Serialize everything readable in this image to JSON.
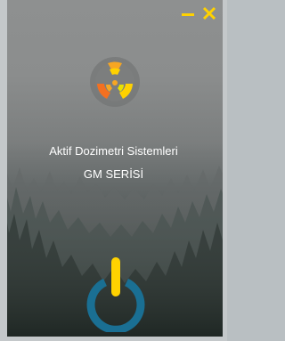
{
  "window": {
    "accent_color": "#ffd200",
    "minimize_icon": "minimize-icon",
    "close_icon": "close-icon"
  },
  "app": {
    "title": "Aktif Dozimetri Sistemleri",
    "subtitle": "GM SERİSİ",
    "logo_icon": "radiation-icon"
  },
  "power": {
    "icon": "power-icon",
    "ring_color": "#1a6f93",
    "bar_color": "#ffd200"
  }
}
